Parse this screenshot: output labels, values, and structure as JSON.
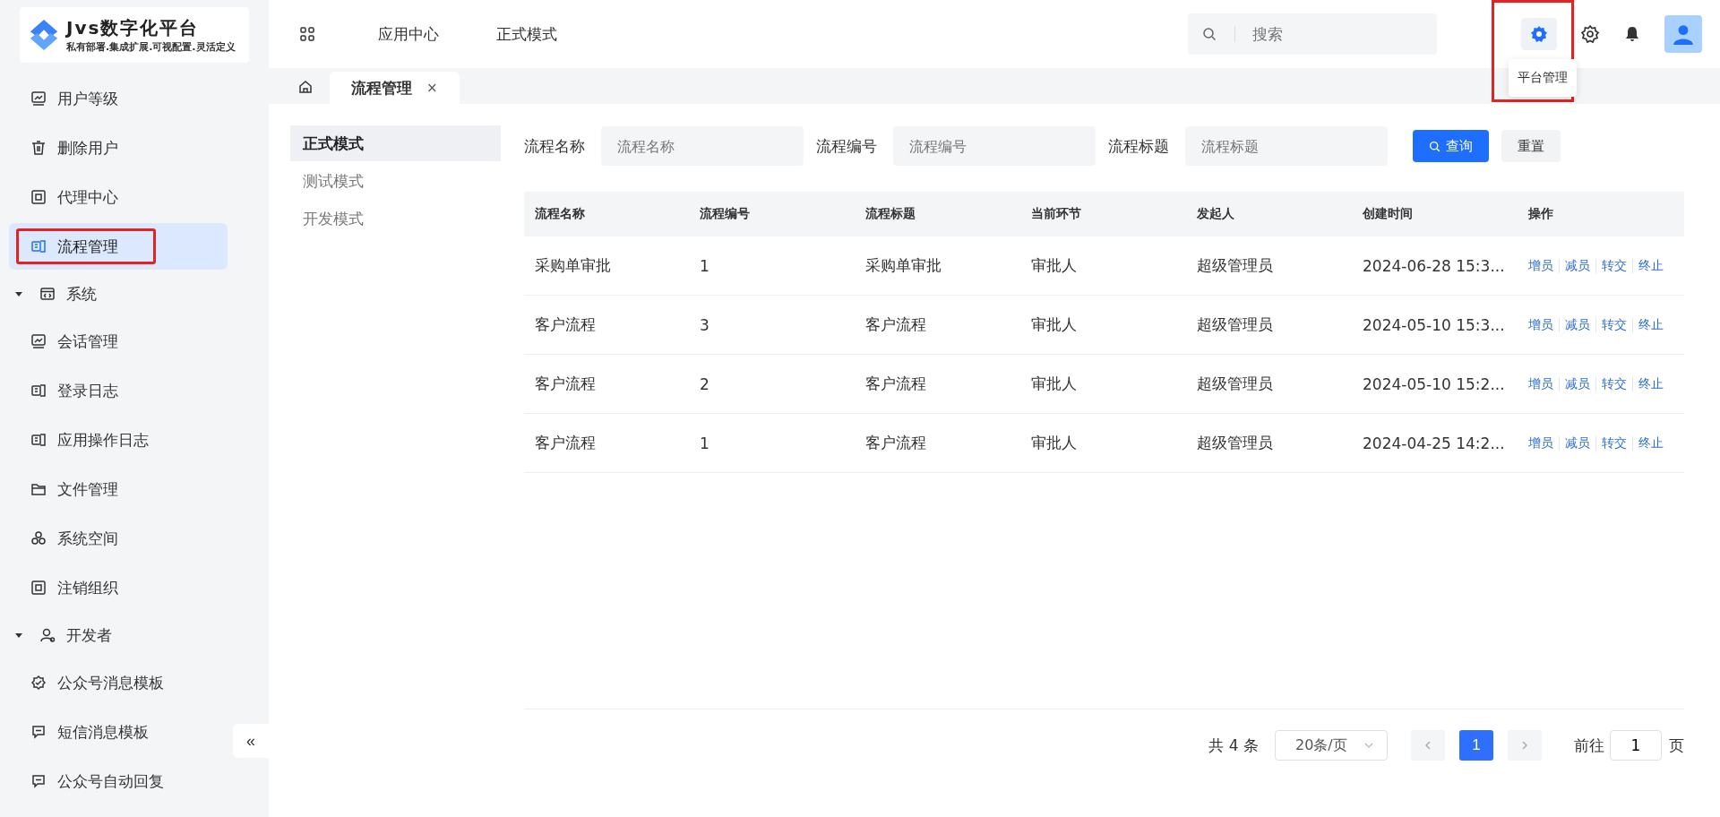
{
  "logo": {
    "title": "Jvs数字化平台",
    "subtitle": "私有部署.集成扩展.可视配置.灵活定义"
  },
  "sidebar": {
    "items": [
      {
        "kind": "item",
        "label": "用户等级",
        "selected": false,
        "annotated": false
      },
      {
        "kind": "item",
        "label": "删除用户",
        "selected": false,
        "annotated": false
      },
      {
        "kind": "item",
        "label": "代理中心",
        "selected": false,
        "annotated": false
      },
      {
        "kind": "item",
        "label": "流程管理",
        "selected": true,
        "annotated": true
      },
      {
        "kind": "group",
        "label": "系统",
        "expanded": true
      },
      {
        "kind": "item",
        "label": "会话管理",
        "selected": false,
        "annotated": false
      },
      {
        "kind": "item",
        "label": "登录日志",
        "selected": false,
        "annotated": false
      },
      {
        "kind": "item",
        "label": "应用操作日志",
        "selected": false,
        "annotated": false
      },
      {
        "kind": "item",
        "label": "文件管理",
        "selected": false,
        "annotated": false
      },
      {
        "kind": "item",
        "label": "系统空间",
        "selected": false,
        "annotated": false
      },
      {
        "kind": "item",
        "label": "注销组织",
        "selected": false,
        "annotated": false
      },
      {
        "kind": "group",
        "label": "开发者",
        "expanded": true
      },
      {
        "kind": "item",
        "label": "公众号消息模板",
        "selected": false,
        "annotated": false
      },
      {
        "kind": "item",
        "label": "短信消息模板",
        "selected": false,
        "annotated": false
      },
      {
        "kind": "item",
        "label": "公众号自动回复",
        "selected": false,
        "annotated": false
      }
    ]
  },
  "collapse_button": "«",
  "topnav": {
    "items": [
      {
        "label": "应用中心"
      },
      {
        "label": "正式模式"
      }
    ]
  },
  "search": {
    "placeholder": "搜索"
  },
  "platform_button": {
    "tooltip": "平台管理",
    "annotated": true
  },
  "tabs": [
    {
      "label": "流程管理",
      "selected": true,
      "close": "×"
    }
  ],
  "modes": [
    {
      "label": "正式模式",
      "selected": true
    },
    {
      "label": "测试模式",
      "selected": false
    },
    {
      "label": "开发模式",
      "selected": false
    }
  ],
  "filters": [
    {
      "label": "流程名称",
      "placeholder": "流程名称"
    },
    {
      "label": "流程编号",
      "placeholder": "流程编号"
    },
    {
      "label": "流程标题",
      "placeholder": "流程标题"
    }
  ],
  "buttons": {
    "query": "查询",
    "reset": "重置"
  },
  "table": {
    "columns": [
      "流程名称",
      "流程编号",
      "流程标题",
      "当前环节",
      "发起人",
      "创建时间",
      "操作"
    ],
    "rows": [
      {
        "cells": [
          "采购单审批",
          "1",
          "采购单审批",
          "审批人",
          "超级管理员",
          "2024-06-28 15:3..."
        ],
        "actions": [
          "增员",
          "减员",
          "转交",
          "终止"
        ]
      },
      {
        "cells": [
          "客户流程",
          "3",
          "客户流程",
          "审批人",
          "超级管理员",
          "2024-05-10 15:3..."
        ],
        "actions": [
          "增员",
          "减员",
          "转交",
          "终止"
        ]
      },
      {
        "cells": [
          "客户流程",
          "2",
          "客户流程",
          "审批人",
          "超级管理员",
          "2024-05-10 15:2..."
        ],
        "actions": [
          "增员",
          "减员",
          "转交",
          "终止"
        ]
      },
      {
        "cells": [
          "客户流程",
          "1",
          "客户流程",
          "审批人",
          "超级管理员",
          "2024-04-25 14:2..."
        ],
        "actions": [
          "增员",
          "减员",
          "转交",
          "终止"
        ]
      }
    ]
  },
  "pagination": {
    "total": "共 4 条",
    "page_size": "20条/页",
    "pages": [
      {
        "label": "1",
        "selected": true
      }
    ],
    "goto_label": "前往",
    "goto_value": "1",
    "page_unit": "页"
  }
}
